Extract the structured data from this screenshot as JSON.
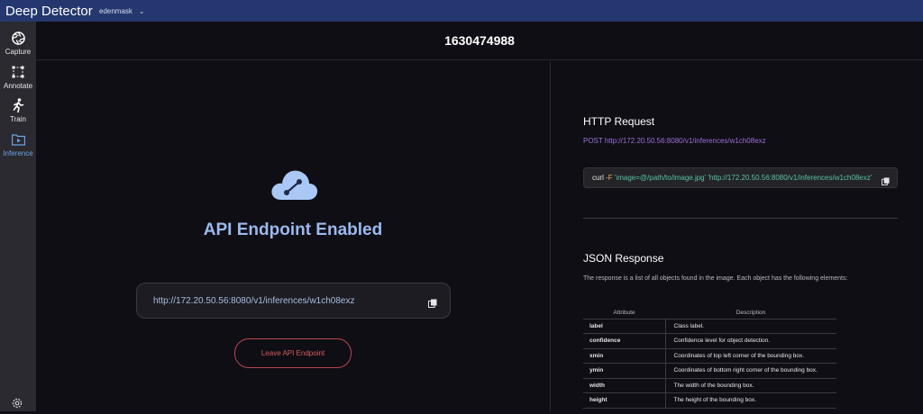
{
  "topbar": {
    "app_title": "Deep Detector",
    "user": "edenmask"
  },
  "sidebar": {
    "items": [
      {
        "label": "Capture",
        "icon": "aperture-icon",
        "active": false
      },
      {
        "label": "Annotate",
        "icon": "bounding-box-icon",
        "active": false
      },
      {
        "label": "Train",
        "icon": "running-person-icon",
        "active": false
      },
      {
        "label": "Inference",
        "icon": "video-folder-icon",
        "active": true
      }
    ],
    "settings_icon": "gear-icon"
  },
  "header": {
    "title": "1630474988"
  },
  "endpoint": {
    "status_title": "API Endpoint Enabled",
    "url": "http://172.20.50.56:8080/v1/inferences/w1ch08exz",
    "leave_label": "Leave API Endpoint"
  },
  "http_request": {
    "title": "HTTP Request",
    "method_line": "POST http://172.20.50.56:8080/v1/inferences/w1ch08exz",
    "curl": {
      "cmd": "curl",
      "flag": "-F",
      "form": "'image=@/path/to/image.jpg'",
      "url": "'http://172.20.50.56:8080/v1/inferences/w1ch08exz'"
    }
  },
  "json_response": {
    "title": "JSON Response",
    "description": "The response is a list of all objects found in the image. Each object has the following elements:",
    "columns": [
      "Attribute",
      "Description"
    ],
    "rows": [
      {
        "attribute": "label",
        "description": "Class label."
      },
      {
        "attribute": "confidence",
        "description": "Confidence level for object detection."
      },
      {
        "attribute": "xmin",
        "description": "Coordinates of top left corner of the bounding box."
      },
      {
        "attribute": "ymin",
        "description": "Coordinates of bottom right corner of the bounding box."
      },
      {
        "attribute": "width",
        "description": "The width of the bounding box."
      },
      {
        "attribute": "height",
        "description": "The height of the bounding box."
      }
    ]
  },
  "colors": {
    "topbar": "#24376e",
    "accent": "#6ea3e6",
    "enabled_title": "#9bb9ef",
    "danger": "#d45c62",
    "post_line": "#9b6fd8",
    "curl_string": "#59c3a6"
  }
}
